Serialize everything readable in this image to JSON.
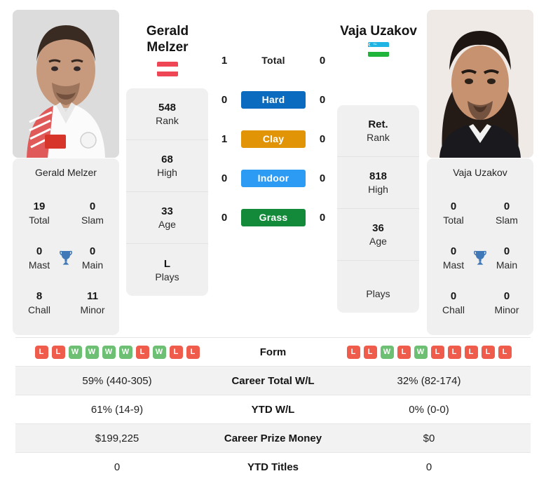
{
  "players": {
    "left": {
      "name_header": "Gerald Melzer",
      "card_name": "Gerald Melzer",
      "flag": "austria-flag",
      "rank": "548",
      "rank_label": "Rank",
      "high": "68",
      "high_label": "High",
      "age": "33",
      "age_label": "Age",
      "plays": "L",
      "plays_label": "Plays",
      "titles": {
        "total": "19",
        "total_label": "Total",
        "slam": "0",
        "slam_label": "Slam",
        "mast": "0",
        "mast_label": "Mast",
        "main": "0",
        "main_label": "Main",
        "chall": "8",
        "chall_label": "Chall",
        "minor": "11",
        "minor_label": "Minor"
      },
      "form": [
        "L",
        "L",
        "W",
        "W",
        "W",
        "W",
        "L",
        "W",
        "L",
        "L"
      ],
      "career_total_wl": "59% (440-305)",
      "ytd_wl": "61% (14-9)",
      "career_prize_money": "$199,225",
      "ytd_titles": "0"
    },
    "right": {
      "name_header": "Vaja Uzakov",
      "card_name": "Vaja Uzakov",
      "flag": "uzbekistan-flag",
      "rank": "Ret.",
      "rank_label": "Rank",
      "high": "818",
      "high_label": "High",
      "age": "36",
      "age_label": "Age",
      "plays": "",
      "plays_label": "Plays",
      "titles": {
        "total": "0",
        "total_label": "Total",
        "slam": "0",
        "slam_label": "Slam",
        "mast": "0",
        "mast_label": "Mast",
        "main": "0",
        "main_label": "Main",
        "chall": "0",
        "chall_label": "Chall",
        "minor": "0",
        "minor_label": "Minor"
      },
      "form": [
        "L",
        "L",
        "W",
        "L",
        "W",
        "L",
        "L",
        "L",
        "L",
        "L"
      ],
      "career_total_wl": "32% (82-174)",
      "ytd_wl": "0% (0-0)",
      "career_prize_money": "$0",
      "ytd_titles": "0"
    }
  },
  "h2h": {
    "rows": [
      {
        "left": "1",
        "label": "Total",
        "right": "0",
        "color": "",
        "style": "plain"
      },
      {
        "left": "0",
        "label": "Hard",
        "right": "0",
        "color": "#0b6cbf",
        "style": "pill"
      },
      {
        "left": "1",
        "label": "Clay",
        "right": "0",
        "color": "#e09406",
        "style": "pill"
      },
      {
        "left": "0",
        "label": "Indoor",
        "right": "0",
        "color": "#2b9bf4",
        "style": "pill"
      },
      {
        "left": "0",
        "label": "Grass",
        "right": "0",
        "color": "#128a3a",
        "style": "pill"
      }
    ]
  },
  "table": {
    "rows": [
      {
        "label": "Form",
        "kind": "form"
      },
      {
        "label": "Career Total W/L",
        "kind": "text",
        "key": "career_total_wl"
      },
      {
        "label": "YTD W/L",
        "kind": "text",
        "key": "ytd_wl"
      },
      {
        "label": "Career Prize Money",
        "kind": "text",
        "key": "career_prize_money"
      },
      {
        "label": "YTD Titles",
        "kind": "text",
        "key": "ytd_titles"
      }
    ]
  },
  "colors": {
    "win": "#6cbf73",
    "loss": "#ef5c4c",
    "card_bg": "#f0f0f0",
    "row_shade": "#f2f2f2"
  }
}
